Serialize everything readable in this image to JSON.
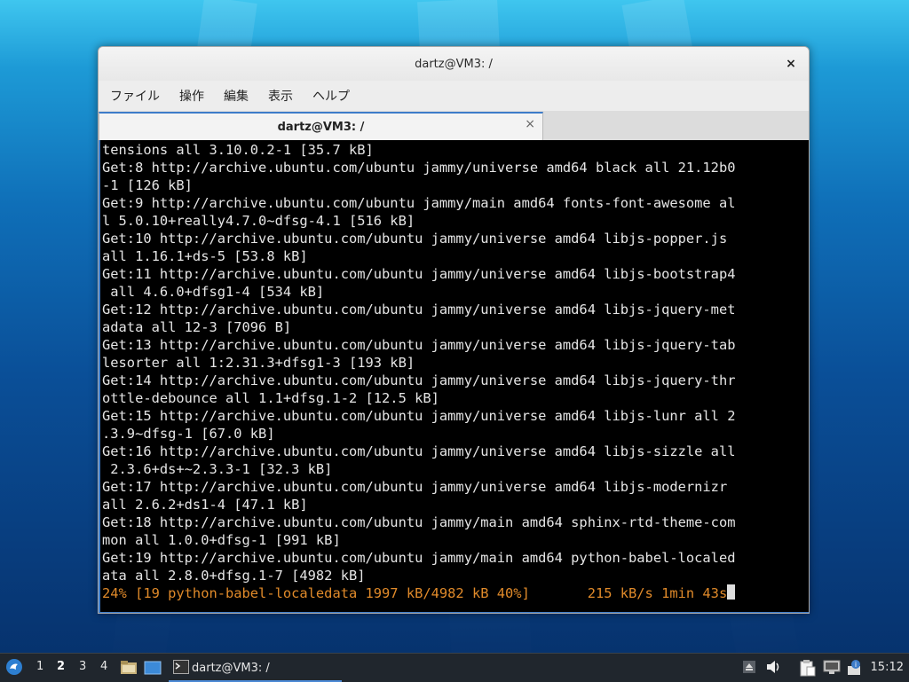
{
  "window": {
    "title": "dartz@VM3: /",
    "close_label": "×",
    "menu": [
      "ファイル",
      "操作",
      "編集",
      "表示",
      "ヘルプ"
    ],
    "tab": {
      "label": "dartz@VM3: /",
      "close_label": "×"
    }
  },
  "terminal": {
    "lines": [
      "tensions all 3.10.0.2-1 [35.7 kB]",
      "Get:8 http://archive.ubuntu.com/ubuntu jammy/universe amd64 black all 21.12b0",
      "-1 [126 kB]",
      "Get:9 http://archive.ubuntu.com/ubuntu jammy/main amd64 fonts-font-awesome al",
      "l 5.0.10+really4.7.0~dfsg-4.1 [516 kB]",
      "Get:10 http://archive.ubuntu.com/ubuntu jammy/universe amd64 libjs-popper.js",
      "all 1.16.1+ds-5 [53.8 kB]",
      "Get:11 http://archive.ubuntu.com/ubuntu jammy/universe amd64 libjs-bootstrap4",
      " all 4.6.0+dfsg1-4 [534 kB]",
      "Get:12 http://archive.ubuntu.com/ubuntu jammy/universe amd64 libjs-jquery-met",
      "adata all 12-3 [7096 B]",
      "Get:13 http://archive.ubuntu.com/ubuntu jammy/universe amd64 libjs-jquery-tab",
      "lesorter all 1:2.31.3+dfsg1-3 [193 kB]",
      "Get:14 http://archive.ubuntu.com/ubuntu jammy/universe amd64 libjs-jquery-thr",
      "ottle-debounce all 1.1+dfsg.1-2 [12.5 kB]",
      "Get:15 http://archive.ubuntu.com/ubuntu jammy/universe amd64 libjs-lunr all 2",
      ".3.9~dfsg-1 [67.0 kB]",
      "Get:16 http://archive.ubuntu.com/ubuntu jammy/universe amd64 libjs-sizzle all",
      " 2.3.6+ds+~2.3.3-1 [32.3 kB]",
      "Get:17 http://archive.ubuntu.com/ubuntu jammy/universe amd64 libjs-modernizr",
      "all 2.6.2+ds1-4 [47.1 kB]",
      "Get:18 http://archive.ubuntu.com/ubuntu jammy/main amd64 sphinx-rtd-theme-com",
      "mon all 1.0.0+dfsg-1 [991 kB]",
      "Get:19 http://archive.ubuntu.com/ubuntu jammy/main amd64 python-babel-localed",
      "ata all 2.8.0+dfsg.1-7 [4982 kB]"
    ],
    "progress_line": "24% [19 python-babel-localedata 1997 kB/4982 kB 40%]       215 kB/s 1min 43s",
    "progress_color": "#e08a2a"
  },
  "taskbar": {
    "workspaces": [
      "1",
      "2",
      "3",
      "4"
    ],
    "active_workspace": "2",
    "task_label": "dartz@VM3: /",
    "clock": "15:12",
    "icons": [
      "start-menu-icon",
      "file-manager-icon",
      "show-desktop-icon",
      "terminal-icon",
      "upload-icon",
      "volume-icon",
      "clipboard-icon",
      "network-icon",
      "notification-icon"
    ]
  }
}
